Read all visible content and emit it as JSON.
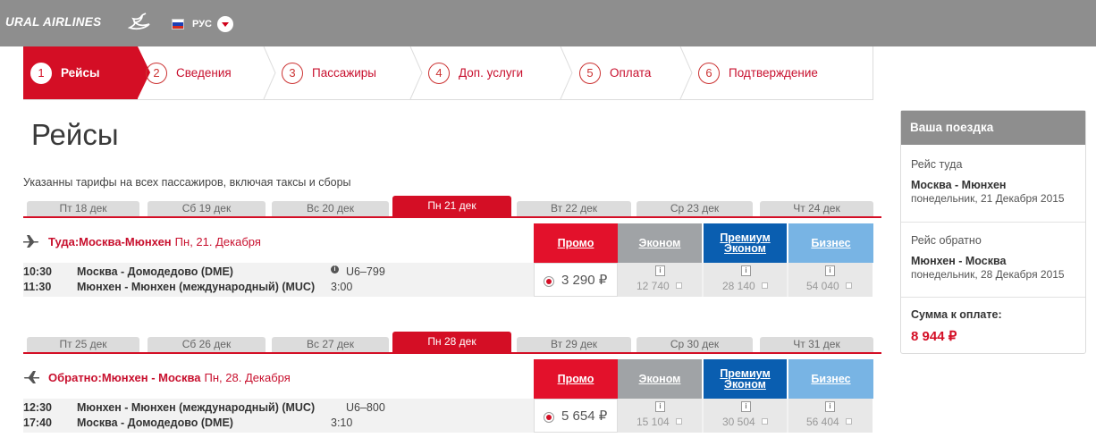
{
  "header": {
    "logo": "URAL AIRLINES",
    "language": "РУС"
  },
  "steps": [
    {
      "num": "1",
      "label": "Рейсы",
      "active": true
    },
    {
      "num": "2",
      "label": "Сведения"
    },
    {
      "num": "3",
      "label": "Пассажиры"
    },
    {
      "num": "4",
      "label": "Доп. услуги"
    },
    {
      "num": "5",
      "label": "Оплата"
    },
    {
      "num": "6",
      "label": "Подтверждение"
    }
  ],
  "page": {
    "title": "Рейсы",
    "note": "Указанны тарифы на всех пассажиров, включая таксы и сборы"
  },
  "fare_classes": {
    "promo": "Промо",
    "economy": "Эконом",
    "premium_line1": "Премиум",
    "premium_line2": "Эконом",
    "business": "Бизнес"
  },
  "outbound": {
    "days": [
      "Пт 18 дек",
      "Сб 19 дек",
      "Вс 20 дек",
      "Пн 21 дек",
      "Вт 22 дек",
      "Ср 23 дек",
      "Чт 24 дек"
    ],
    "direction_label": "Туда: ",
    "route": "Москва-Мюнхен",
    "date": "Пн, 21. Декабря",
    "dep_time": "10:30",
    "arr_time": "11:30",
    "dep_airport": "Москва - Домодедово (DME)",
    "arr_airport": "Мюнхен - Мюнхен (международный) (MUC)",
    "flight": "U6–799",
    "duration": "3:00",
    "promo_price": "3 290 ₽",
    "economy_price": "12 740",
    "premium_price": "28 140",
    "business_price": "54 040"
  },
  "inbound": {
    "days": [
      "Пт 25 дек",
      "Сб 26 дек",
      "Вс 27 дек",
      "Пн 28 дек",
      "Вт 29 дек",
      "Ср 30 дек",
      "Чт 31 дек"
    ],
    "direction_label": "Обратно: ",
    "route": "Мюнхен - Москва",
    "date": "Пн, 28. Декабря",
    "dep_time": "12:30",
    "arr_time": "17:40",
    "dep_airport": "Мюнхен - Мюнхен (международный) (MUC)",
    "arr_airport": "Москва - Домодедово (DME)",
    "flight": "U6–800",
    "duration": "3:10",
    "promo_price": "5 654 ₽",
    "economy_price": "15 104",
    "premium_price": "30 504",
    "business_price": "56 404"
  },
  "sidebar": {
    "title": "Ваша поездка",
    "out_label": "Рейс туда",
    "out_route": "Москва - Мюнхен",
    "out_date": "понедельник, 21 Декабря 2015",
    "ret_label": "Рейс обратно",
    "ret_route": "Мюнхен - Москва",
    "ret_date": "понедельник, 28 Декабря 2015",
    "sum_label": "Сумма к оплате:",
    "sum": "8 944 ₽"
  },
  "colors": {
    "header_gray": "#8e8e8e",
    "brand_red": "#d40e25",
    "promo_red": "#e3112b",
    "economy_gray": "#a0a3a6",
    "premium_blue": "#0a5eb0",
    "business_lightblue": "#78b4e4"
  },
  "icons": {
    "logo": "swan-logo-icon",
    "flag": "russia-flag-icon",
    "lang_dropdown": "chevron-down-icon",
    "plane": "plane-icon",
    "info": "info-icon"
  }
}
